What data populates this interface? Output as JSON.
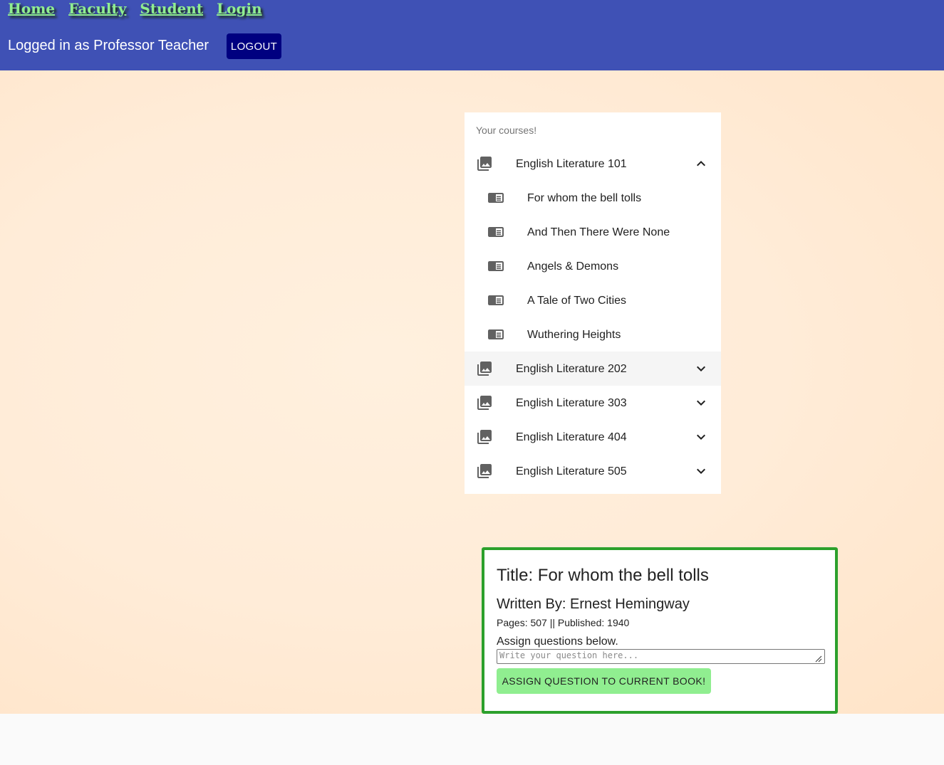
{
  "nav": {
    "home": "Home",
    "faculty": "Faculty",
    "student": "Student",
    "login": "Login"
  },
  "session": {
    "logged_in_text": "Logged in as Professor Teacher",
    "logout_label": "LOGOUT"
  },
  "courses": {
    "header": "Your courses!",
    "items": [
      {
        "label": "English Literature 101",
        "icon": "photo-library-icon",
        "expanded": true,
        "books": [
          {
            "label": "For whom the bell tolls",
            "icon": "book-icon"
          },
          {
            "label": "And Then There Were None",
            "icon": "book-icon"
          },
          {
            "label": "Angels & Demons",
            "icon": "book-icon"
          },
          {
            "label": "A Tale of Two Cities",
            "icon": "book-icon"
          },
          {
            "label": "Wuthering Heights",
            "icon": "book-icon"
          }
        ]
      },
      {
        "label": "English Literature 202",
        "icon": "photo-library-icon",
        "expanded": false
      },
      {
        "label": "English Literature 303",
        "icon": "photo-library-icon",
        "expanded": false
      },
      {
        "label": "English Literature 404",
        "icon": "photo-library-icon",
        "expanded": false
      },
      {
        "label": "English Literature 505",
        "icon": "photo-library-icon",
        "expanded": false
      }
    ]
  },
  "book_detail": {
    "title": "Title: For whom the bell tolls",
    "author": "Written By: Ernest Hemingway",
    "meta": "Pages: 507 || Published: 1940",
    "assign_text": "Assign questions below.",
    "question_placeholder": "Write your question here...",
    "assign_button": "ASSIGN QUESTION TO CURRENT BOOK!"
  },
  "colors": {
    "topbar": "#3f51b5",
    "nav_link": "#90ee90",
    "logout_bg": "#000080",
    "card_border": "#2ca02c",
    "assign_button_bg": "#90ee90"
  }
}
